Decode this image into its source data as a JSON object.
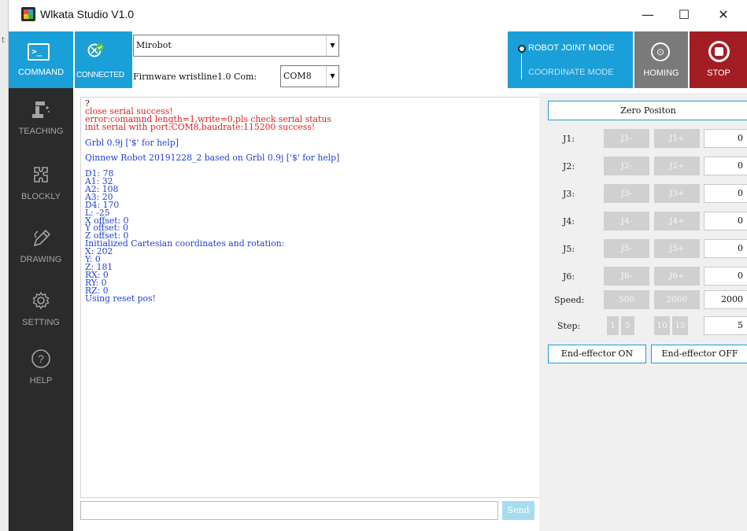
{
  "outer_strip_text": "t",
  "window": {
    "title": "Wlkata Studio V1.0",
    "controls": {
      "minimize": "—",
      "maximize": "☐",
      "close": "✕"
    }
  },
  "toolbar": {
    "command_label": "COMMAND",
    "connected_label": "CONNECTED",
    "robot_select": "Mirobot",
    "firmware_label": "Firmware wristline1.0 Com:",
    "com_select": "COM8",
    "mode_joint": "ROBOT JOINT MODE",
    "mode_coordinate": "COORDINATE MODE",
    "homing_label": "HOMING",
    "stop_label": "STOP"
  },
  "sidebar": {
    "items": [
      {
        "label": "TEACHING",
        "icon": "robot-arm-icon"
      },
      {
        "label": "BLOCKLY",
        "icon": "puzzle-icon"
      },
      {
        "label": "DRAWING",
        "icon": "pen-icon"
      },
      {
        "label": "SETTING",
        "icon": "gear-icon"
      },
      {
        "label": "HELP",
        "icon": "help-icon"
      }
    ]
  },
  "console": {
    "lines": [
      {
        "text": "?",
        "color": "blk"
      },
      {
        "text": "close serial success!",
        "color": "red"
      },
      {
        "text": "error:comamnd length=1,write=0,pls check serial status",
        "color": "red"
      },
      {
        "text": "init serial with port:COM8,baudrate:115200 success!",
        "color": "red"
      },
      {
        "text": "",
        "color": "blue"
      },
      {
        "text": "Grbl 0.9j ['$' for help]",
        "color": "blue"
      },
      {
        "text": "",
        "color": "blue"
      },
      {
        "text": "Qinnew Robot 20191228_2 based on Grbl 0.9j ['$' for help]",
        "color": "blue"
      },
      {
        "text": "",
        "color": "blue"
      },
      {
        "text": "D1: 78",
        "color": "blue"
      },
      {
        "text": "A1: 32",
        "color": "blue"
      },
      {
        "text": "A2: 108",
        "color": "blue"
      },
      {
        "text": "A3: 20",
        "color": "blue"
      },
      {
        "text": "D4: 170",
        "color": "blue"
      },
      {
        "text": "L: -25",
        "color": "blue"
      },
      {
        "text": "X offset: 0",
        "color": "blue"
      },
      {
        "text": "Y offset: 0",
        "color": "blue"
      },
      {
        "text": "Z offset: 0",
        "color": "blue"
      },
      {
        "text": "Initialized Cartesian coordinates and rotation:",
        "color": "blue"
      },
      {
        "text": "X: 202",
        "color": "blue"
      },
      {
        "text": "Y: 0",
        "color": "blue"
      },
      {
        "text": "Z: 181",
        "color": "blue"
      },
      {
        "text": "RX: 0",
        "color": "blue"
      },
      {
        "text": "RY: 0",
        "color": "blue"
      },
      {
        "text": "RZ: 0",
        "color": "blue"
      },
      {
        "text": "Using reset pos!",
        "color": "blue"
      }
    ],
    "input_value": "",
    "send_label": "Send"
  },
  "joints": {
    "zero_label": "Zero Positon",
    "rows": [
      {
        "label": "J1:",
        "minus": "J1-",
        "plus": "J1+",
        "value": "0"
      },
      {
        "label": "J2:",
        "minus": "J2-",
        "plus": "J2+",
        "value": "0"
      },
      {
        "label": "J3:",
        "minus": "J3-",
        "plus": "J3+",
        "value": "0"
      },
      {
        "label": "J4:",
        "minus": "J4-",
        "plus": "J4+",
        "value": "0"
      },
      {
        "label": "J5:",
        "minus": "J5-",
        "plus": "J5+",
        "value": "0"
      },
      {
        "label": "J6:",
        "minus": "J6-",
        "plus": "J6+",
        "value": "0"
      }
    ],
    "speed": {
      "label": "Speed:",
      "opt1": "500",
      "opt2": "2000",
      "value": "2000"
    },
    "step": {
      "label": "Step:",
      "opts": [
        "1",
        "5",
        "10",
        "15"
      ],
      "value": "5"
    },
    "ee_on": "End-effector ON",
    "ee_off": "End-effector OFF"
  },
  "colors": {
    "accent": "#1b9fd8",
    "sidebar": "#2b2b2b",
    "stop": "#a31d25",
    "homing": "#7a7a7a",
    "error_text": "#e31e1e",
    "info_text": "#1f3fd6"
  }
}
